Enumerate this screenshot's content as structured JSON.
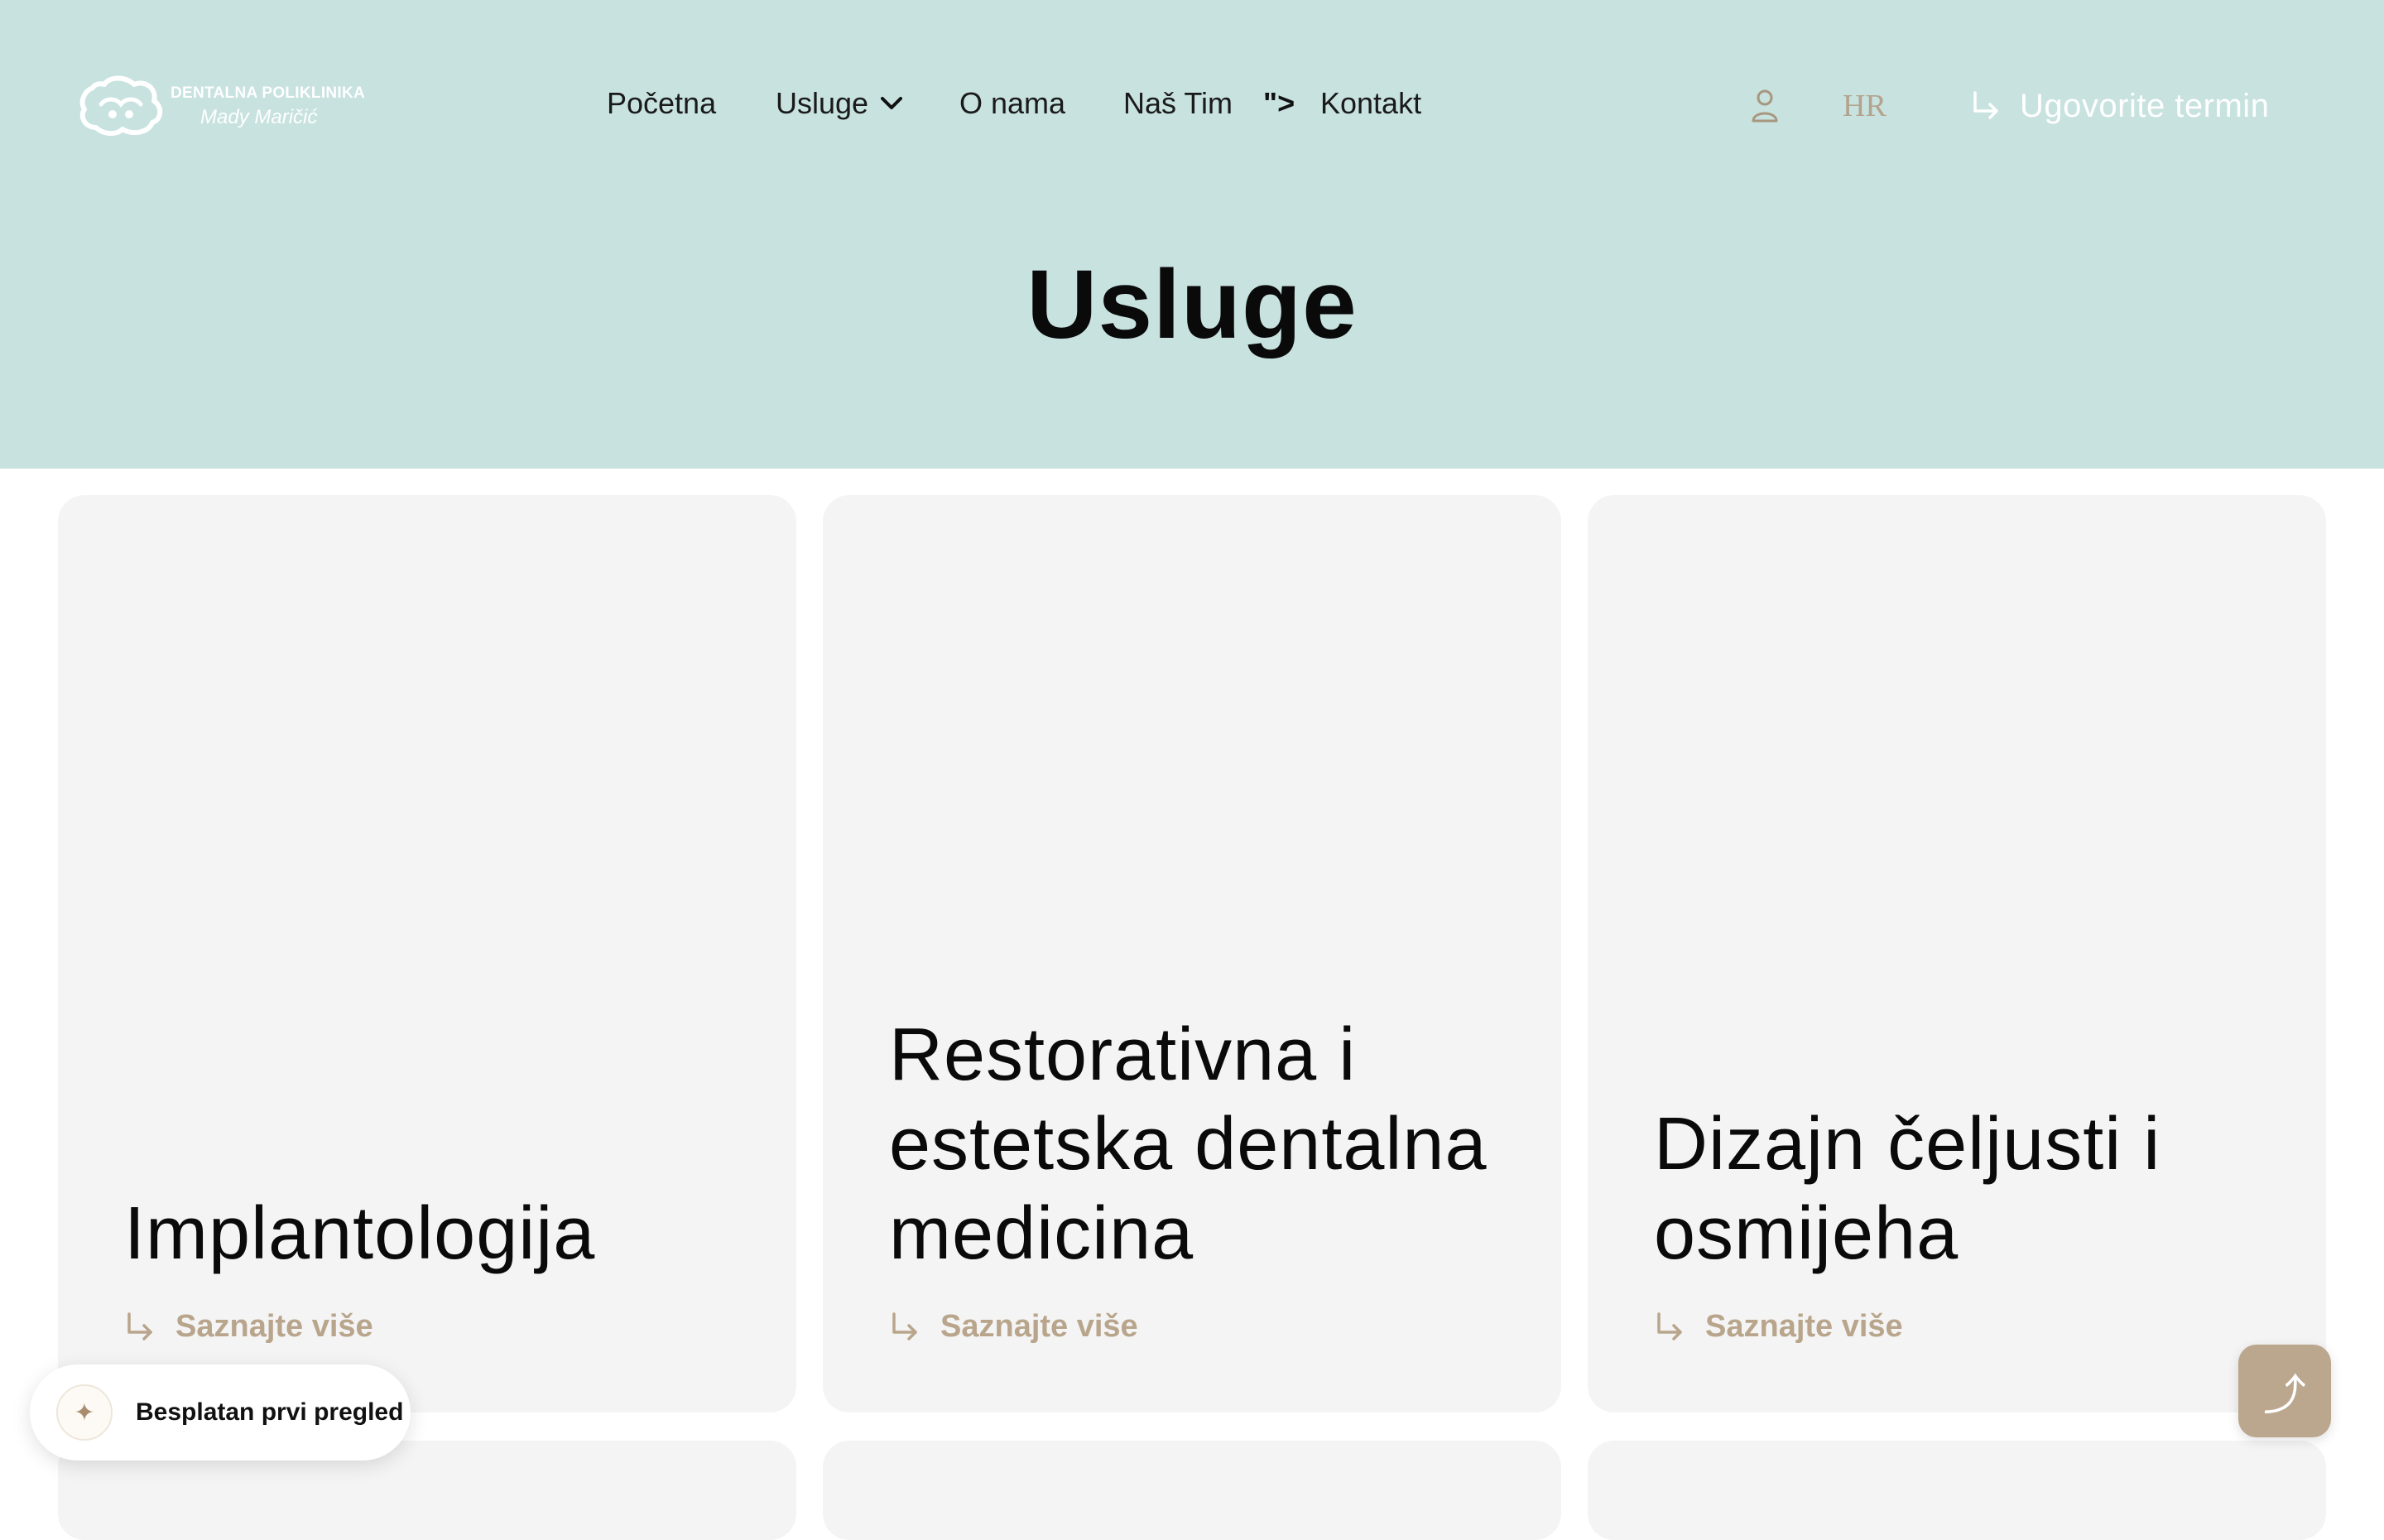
{
  "header": {
    "logo": {
      "line1": "DENTALNA POLIKLINIKA",
      "line2": "Mady Maričić"
    },
    "nav": [
      {
        "label": "Početna"
      },
      {
        "label": "Usluge"
      },
      {
        "label": "O nama"
      },
      {
        "label": "Naš Tim"
      },
      {
        "label": "Kontakt"
      }
    ],
    "stray_text": "\">",
    "language": "HR",
    "cta_label": "Ugovorite termin"
  },
  "page": {
    "title": "Usluge"
  },
  "services": [
    {
      "title": "Implantologija",
      "link": "Saznajte više"
    },
    {
      "title": "Restorativna i estetska dentalna medicina",
      "link": "Saznajte više"
    },
    {
      "title": "Dizajn čeljusti i osmijeha",
      "link": "Saznajte više"
    }
  ],
  "promo": {
    "label": "Besplatan prvi pregled",
    "icon": "sparkle-icon"
  },
  "scroll_top": {
    "icon": "arrow-up-icon"
  },
  "colors": {
    "hero_bg": "#c7e2df",
    "card_bg": "#f4f4f4",
    "accent_gold": "#b8a58c",
    "button_gold": "#bba78e",
    "text_dark": "#0a0a0a"
  }
}
